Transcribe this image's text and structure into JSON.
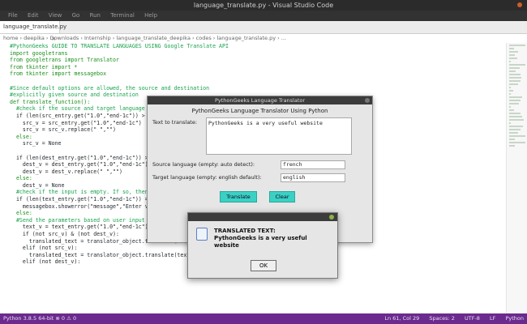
{
  "window": {
    "title": "language_translate.py - Visual Studio Code"
  },
  "menu": [
    "File",
    "Edit",
    "View",
    "Go",
    "Run",
    "Terminal",
    "Help"
  ],
  "tab": {
    "label": "language_translate.py",
    "close": "×"
  },
  "breadcrumb": "home › deepika › Downloads › Internship › language_translate_deepika › codes › language_translate.py › ...",
  "code": [
    {
      "cls": "cm",
      "text": "#PythonGeeks GUIDE TO TRANSLATE LANGUAGES USING Google Translate API"
    },
    {
      "cls": "kw",
      "text": "import googletrans"
    },
    {
      "cls": "kw",
      "text": "from googletrans import Translator"
    },
    {
      "cls": "kw",
      "text": "from tkinter import *"
    },
    {
      "cls": "kw",
      "text": "from tkinter import messagebox"
    },
    {
      "cls": "",
      "text": ""
    },
    {
      "cls": "cm",
      "text": "#Since default options are allowed, the source and destination"
    },
    {
      "cls": "cm",
      "text": "#explicitly given source and destination"
    },
    {
      "cls": "kw",
      "text": "def translate_function():"
    },
    {
      "cls": "cm",
      "text": "  #check if the source and target language"
    },
    {
      "cls": "",
      "text": "  if (len(src_entry.get(\"1.0\",\"end-1c\")) > 0):"
    },
    {
      "cls": "",
      "text": "    src_v = src_entry.get(\"1.0\",\"end-1c\")"
    },
    {
      "cls": "",
      "text": "    src_v = src_v.replace(\" \",\"\")"
    },
    {
      "cls": "kw",
      "text": "  else:"
    },
    {
      "cls": "",
      "text": "    src_v = None"
    },
    {
      "cls": "",
      "text": ""
    },
    {
      "cls": "",
      "text": "  if (len(dest_entry.get(\"1.0\",\"end-1c\")) > 0):"
    },
    {
      "cls": "",
      "text": "    dest_v = dest_entry.get(\"1.0\",\"end-1c\")"
    },
    {
      "cls": "",
      "text": "    dest_v = dest_v.replace(\" \",\"\")"
    },
    {
      "cls": "kw",
      "text": "  else:"
    },
    {
      "cls": "",
      "text": "    dest_v = None"
    },
    {
      "cls": "cm",
      "text": "  #check if the input is empty. If so, then"
    },
    {
      "cls": "",
      "text": "  if (len(text_entry.get(\"1.0\",\"end-1c\")) == 0):"
    },
    {
      "cls": "",
      "text": "    messagebox.showerror(\"message\",\"Enter valid text\")"
    },
    {
      "cls": "kw",
      "text": "  else:"
    },
    {
      "cls": "cm",
      "text": "  #Send the parameters based on user input provided"
    },
    {
      "cls": "",
      "text": "    text_v = text_entry.get(\"1.0\",\"end-1c\")"
    },
    {
      "cls": "",
      "text": "    if (not src_v) & (not dest_v):"
    },
    {
      "cls": "",
      "text": "      translated_text = translator_object.translate(text_v)"
    },
    {
      "cls": "",
      "text": "    elif (not src_v):"
    },
    {
      "cls": "",
      "text": "      translated_text = translator_object.translate(text_v,dest=dest_v)"
    },
    {
      "cls": "",
      "text": "    elif (not dest_v):"
    }
  ],
  "statusbar": {
    "left": "Python 3.8.5 64-bit   ⊗ 0 ⚠ 0",
    "right": [
      "Ln 61, Col 29",
      "Spaces: 2",
      "UTF-8",
      "LF",
      "Python"
    ]
  },
  "app": {
    "title": "PythonGeeks Language Translator",
    "heading": "PythonGeeks Language Translator Using Python",
    "text_label": "Text to translate:",
    "text_value": "PythonGeeks is a very useful website",
    "src_label": "Source language (empty: auto detect):",
    "src_value": "french",
    "dest_label": "Target language (empty: english default):",
    "dest_value": "english",
    "translate_button": "Translate",
    "clear_button": "Clear"
  },
  "dialog": {
    "message": "TRANSLATED TEXT:\nPythonGeeks is a very useful website",
    "ok": "OK"
  }
}
